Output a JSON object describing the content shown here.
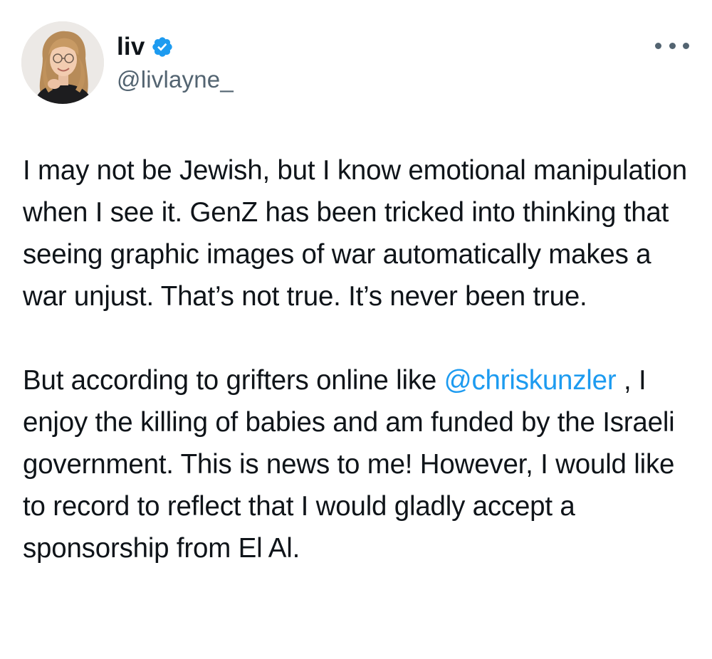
{
  "author": {
    "display_name": "liv",
    "handle": "@livlayne_",
    "verified": true,
    "verified_color": "#1d9bf0"
  },
  "icons": {
    "more": "more-horizontal-icon",
    "verified": "verified-badge-icon"
  },
  "tweet": {
    "paragraph1": "I may not be Jewish, but I know emotional manipulation when I see it. GenZ has been tricked into thinking that seeing graphic images of war automatically makes a war unjust. That’s not true. It’s never been true.",
    "paragraph2_before": "But according to grifters online like ",
    "mention": "@chriskunzler",
    "paragraph2_after": " , I enjoy the killing of babies and am funded by the Israeli government. This is news to me! However, I would like to record to reflect that I would gladly accept a sponsorship from El Al."
  },
  "colors": {
    "text": "#0f1419",
    "secondary": "#536471",
    "link": "#1d9bf0"
  }
}
